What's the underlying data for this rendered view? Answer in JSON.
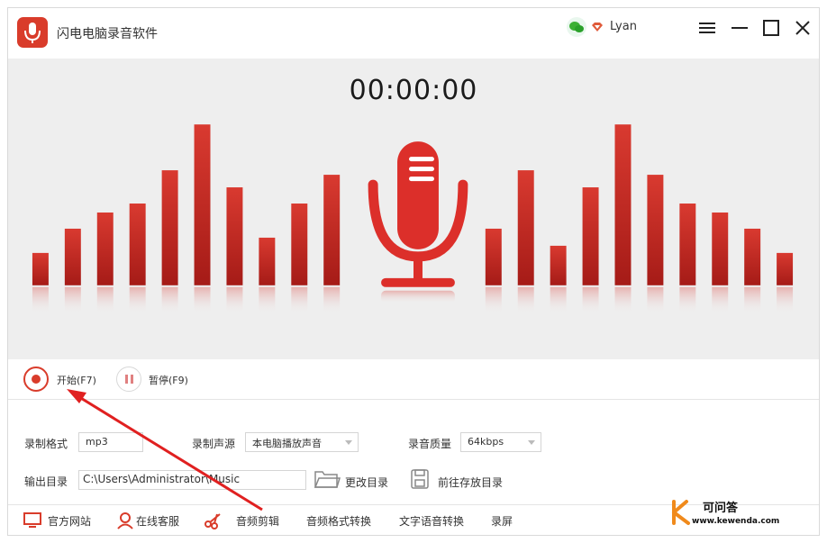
{
  "app": {
    "title": "闪电电脑录音软件"
  },
  "user": {
    "name": "Lyan"
  },
  "timer": "00:00:00",
  "controls": {
    "start_label": "开始(F7)",
    "pause_label": "暂停(F9)"
  },
  "settings": {
    "format_label": "录制格式",
    "format_value": "mp3",
    "source_label": "录制声源",
    "source_value": "本电脑播放声音",
    "quality_label": "录音质量",
    "quality_value": "64kbps",
    "output_label": "输出目录",
    "output_value": "C:\\Users\\Administrator\\Music",
    "change_dir_label": "更改目录",
    "open_dir_label": "前往存放目录"
  },
  "footer": {
    "website": "官方网站",
    "support": "在线客服",
    "audio_edit": "音频剪辑",
    "format_convert": "音频格式转换",
    "tts": "文字语音转换",
    "screen_record": "录屏"
  },
  "watermark": {
    "brand": "可问答",
    "url": "www.kewenda.com"
  },
  "colors": {
    "accent": "#d93c2b",
    "stage_bg": "#eeeeee"
  }
}
